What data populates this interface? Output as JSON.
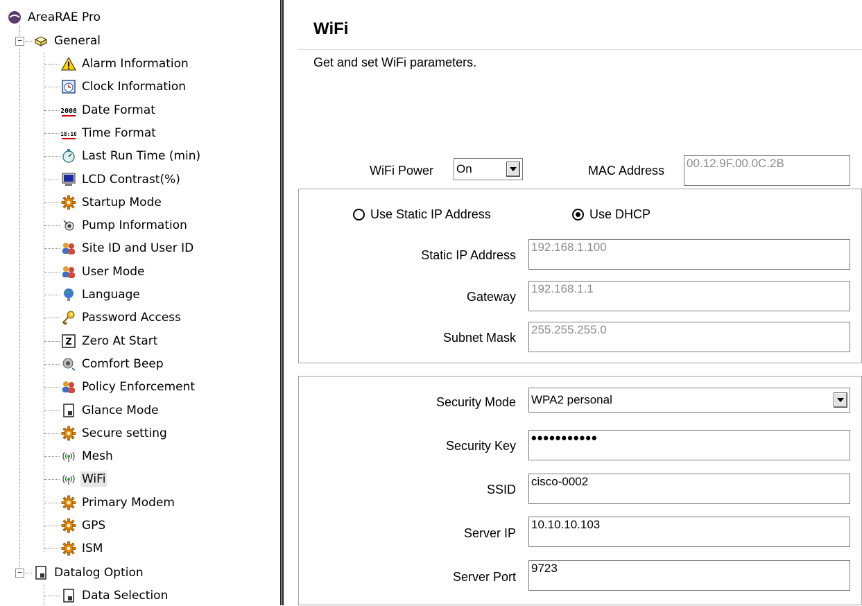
{
  "tree": {
    "root": {
      "label": "AreaRAE Pro",
      "icon": "device-icon"
    },
    "general": {
      "label": "General",
      "icon": "folder-cube-icon",
      "expander": "−"
    },
    "general_items": [
      {
        "id": "alarm",
        "label": "Alarm Information",
        "icon": "warning-icon"
      },
      {
        "id": "clock",
        "label": "Clock Information",
        "icon": "clock-icon"
      },
      {
        "id": "date",
        "label": "Date Format",
        "icon": "date-format-icon",
        "glyph": "2008"
      },
      {
        "id": "time",
        "label": "Time Format",
        "icon": "time-format-icon",
        "glyph": "18:10"
      },
      {
        "id": "lastrun",
        "label": "Last Run Time (min)",
        "icon": "stopwatch-icon"
      },
      {
        "id": "lcd",
        "label": "LCD Contrast(%)",
        "icon": "monitor-icon"
      },
      {
        "id": "startup",
        "label": "Startup Mode",
        "icon": "gear-icon"
      },
      {
        "id": "pump",
        "label": "Pump Information",
        "icon": "pump-icon"
      },
      {
        "id": "siteid",
        "label": "Site ID and User ID",
        "icon": "users-icon"
      },
      {
        "id": "usermode",
        "label": "User Mode",
        "icon": "users-icon"
      },
      {
        "id": "language",
        "label": "Language",
        "icon": "globe-icon"
      },
      {
        "id": "password",
        "label": "Password Access",
        "icon": "key-icon"
      },
      {
        "id": "zero",
        "label": "Zero At Start",
        "icon": "zero-icon",
        "glyph": "Z"
      },
      {
        "id": "beep",
        "label": "Comfort Beep",
        "icon": "speaker-icon"
      },
      {
        "id": "policy",
        "label": "Policy Enforcement",
        "icon": "users-icon"
      },
      {
        "id": "glance",
        "label": "Glance Mode",
        "icon": "document-icon"
      },
      {
        "id": "secure",
        "label": "Secure setting",
        "icon": "gear-icon"
      },
      {
        "id": "mesh",
        "label": "Mesh",
        "icon": "wireless-icon",
        "glyph": "((•))"
      },
      {
        "id": "wifi",
        "label": "WiFi",
        "icon": "wireless-icon",
        "glyph": "((•))",
        "selected": true
      },
      {
        "id": "modem",
        "label": "Primary Modem",
        "icon": "gear-icon"
      },
      {
        "id": "gps",
        "label": "GPS",
        "icon": "gear-icon"
      },
      {
        "id": "ism",
        "label": "ISM",
        "icon": "gear-icon"
      }
    ],
    "datalog": {
      "label": "Datalog Option",
      "icon": "document-icon",
      "expander": "−"
    },
    "datalog_items": [
      {
        "id": "datasel",
        "label": "Data Selection",
        "icon": "document-icon"
      }
    ]
  },
  "panel": {
    "title": "WiFi",
    "subtitle": "Get and set WiFi parameters.",
    "wifi_power": {
      "label": "WiFi Power",
      "value": "On"
    },
    "mac": {
      "label": "MAC Address",
      "value": "00.12.9F.00.0C.2B"
    },
    "ip_mode": {
      "static_label": "Use Static IP Address",
      "dhcp_label": "Use DHCP",
      "selected": "dhcp"
    },
    "static_ip": {
      "label": "Static IP Address",
      "value": "192.168.1.100"
    },
    "gateway": {
      "label": "Gateway",
      "value": "192.168.1.1"
    },
    "subnet": {
      "label": "Subnet Mask",
      "value": "255.255.255.0"
    },
    "security_mode": {
      "label": "Security Mode",
      "value": "WPA2 personal"
    },
    "security_key": {
      "label": "Security Key",
      "value": "•••••••••••"
    },
    "ssid": {
      "label": "SSID",
      "value": "cisco-0002"
    },
    "server_ip": {
      "label": "Server IP",
      "value": "10.10.10.103"
    },
    "server_port": {
      "label": "Server Port",
      "value": "9723"
    }
  },
  "colors": {
    "gear": "#e88a00",
    "warning": "#ffd400",
    "selection": "#e6e6e6",
    "border": "#7a7a7a"
  }
}
